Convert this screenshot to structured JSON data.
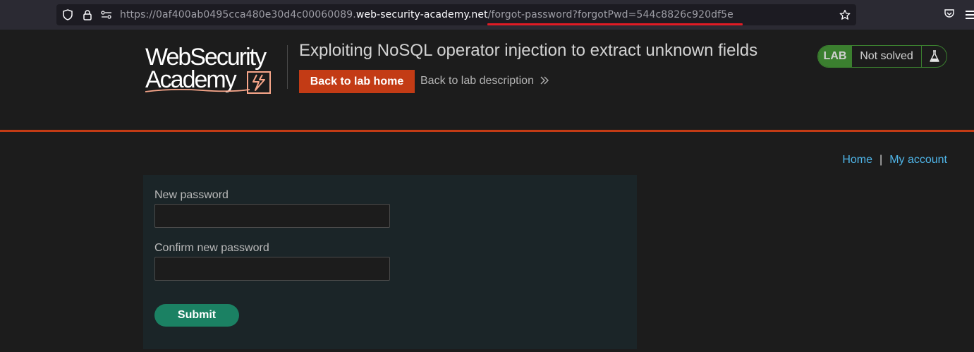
{
  "browser": {
    "url_prefix": "https://0af400ab0495cca480e30d4c00060089.",
    "url_domain": "web-security-academy.net",
    "url_path": "/forgot-password?forgotPwd=544c8826c920df5e"
  },
  "header": {
    "logo_line1": "WebSecurity",
    "logo_line2": "Academy",
    "lab_title": "Exploiting NoSQL operator injection to extract unknown fields",
    "back_home_label": "Back to lab home",
    "back_desc_label": "Back to lab description",
    "lab_badge": "LAB",
    "lab_status": "Not solved"
  },
  "nav": {
    "home": "Home",
    "separator": "|",
    "account": "My account"
  },
  "form": {
    "new_password_label": "New password",
    "new_password_value": "",
    "confirm_password_label": "Confirm new password",
    "confirm_password_value": "",
    "submit_label": "Submit"
  },
  "colors": {
    "accent_orange": "#c33b15",
    "lab_green": "#3b7f2f",
    "submit_green": "#1b8163",
    "link_blue": "#4fb5e8"
  }
}
